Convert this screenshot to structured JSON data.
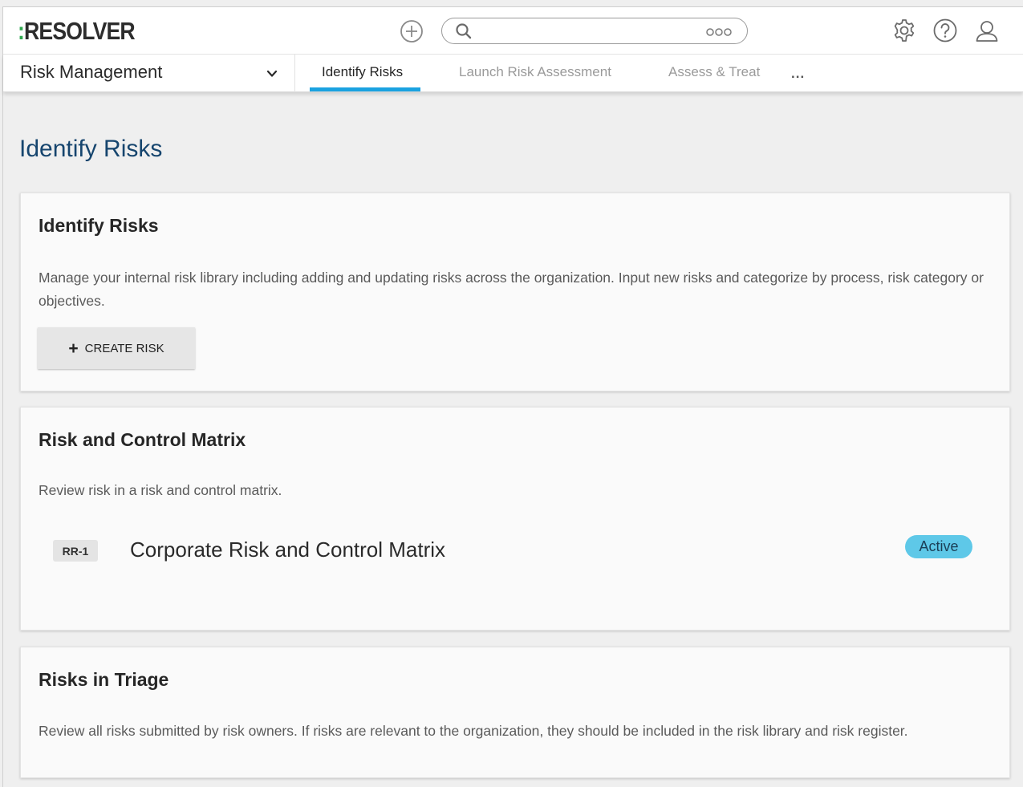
{
  "header": {
    "logo_prefix": ":",
    "logo_text": "RESOLVER",
    "search_placeholder": "",
    "icons": [
      "add-icon",
      "search-icon",
      "more-options-icon",
      "settings-icon",
      "help-icon",
      "user-icon"
    ]
  },
  "nav": {
    "app_name": "Risk Management",
    "tabs": [
      {
        "label": "Identify Risks",
        "active": true
      },
      {
        "label": "Launch Risk Assessment",
        "active": false
      },
      {
        "label": "Assess & Treat",
        "active": false
      }
    ],
    "more_label": "..."
  },
  "page": {
    "title": "Identify Risks"
  },
  "cards": {
    "identify": {
      "title": "Identify Risks",
      "description": "Manage your internal risk library including adding and updating risks across the organization. Input new risks and categorize by process, risk category or objectives.",
      "button_label": "CREATE RISK"
    },
    "matrix": {
      "title": "Risk and Control Matrix",
      "description": "Review risk in a risk and control matrix.",
      "items": [
        {
          "id": "RR-1",
          "name": "Corporate Risk and Control Matrix",
          "status": "Active"
        }
      ]
    },
    "triage": {
      "title": "Risks in Triage",
      "description": "Review all risks submitted by risk owners. If risks are relevant to the organization, they should be included in the risk library and risk register."
    }
  },
  "colors": {
    "accent": "#1aa2e0",
    "logo_accent": "#2fa84f",
    "title": "#16456e",
    "status_active": "#5ec8e8"
  }
}
